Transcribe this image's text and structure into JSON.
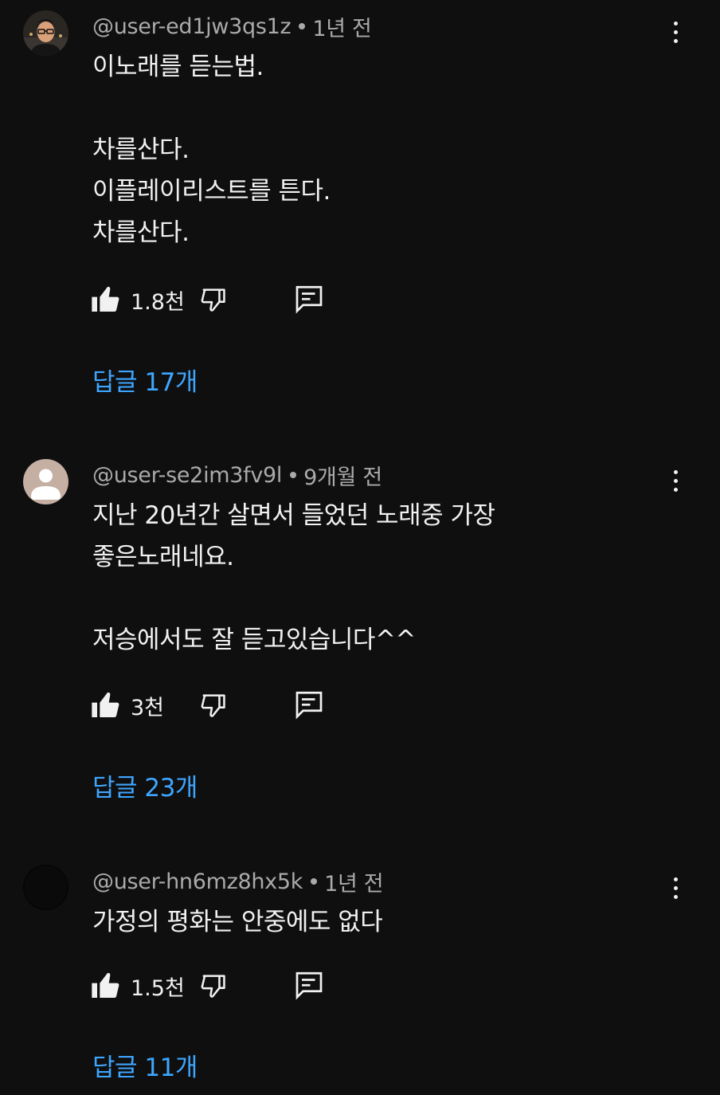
{
  "comments": [
    {
      "author": "@user-ed1jw3qs1z",
      "time": "1년 전",
      "text": "이노래를 듣는법.\n\n차를산다.\n이플레이리스트를 튼다.\n차를산다.",
      "likes": "1.8천",
      "replies_label": "답글 17개",
      "avatar": "photo-avatar"
    },
    {
      "author": "@user-se2im3fv9l",
      "time": "9개월 전",
      "text": "지난 20년간 살면서 들었던 노래중 가장\n좋은노래네요.\n\n저승에서도 잘 듣고있습니다^^",
      "likes": "3천",
      "replies_label": "답글 23개",
      "avatar": "default-avatar"
    },
    {
      "author": "@user-hn6mz8hx5k",
      "time": "1년 전",
      "text": "가정의 평화는 안중에도 없다",
      "likes": "1.5천",
      "replies_label": "답글 11개",
      "avatar": "dark-avatar"
    }
  ],
  "icons": {
    "like": "thumbs-up-icon",
    "dislike": "thumbs-down-icon",
    "reply": "comment-reply-icon",
    "more": "more-vertical-icon"
  },
  "colors": {
    "background": "#0f0f0f",
    "text": "#f1f1f1",
    "secondary_text": "#aaaaaa",
    "link": "#3ea6ff"
  }
}
